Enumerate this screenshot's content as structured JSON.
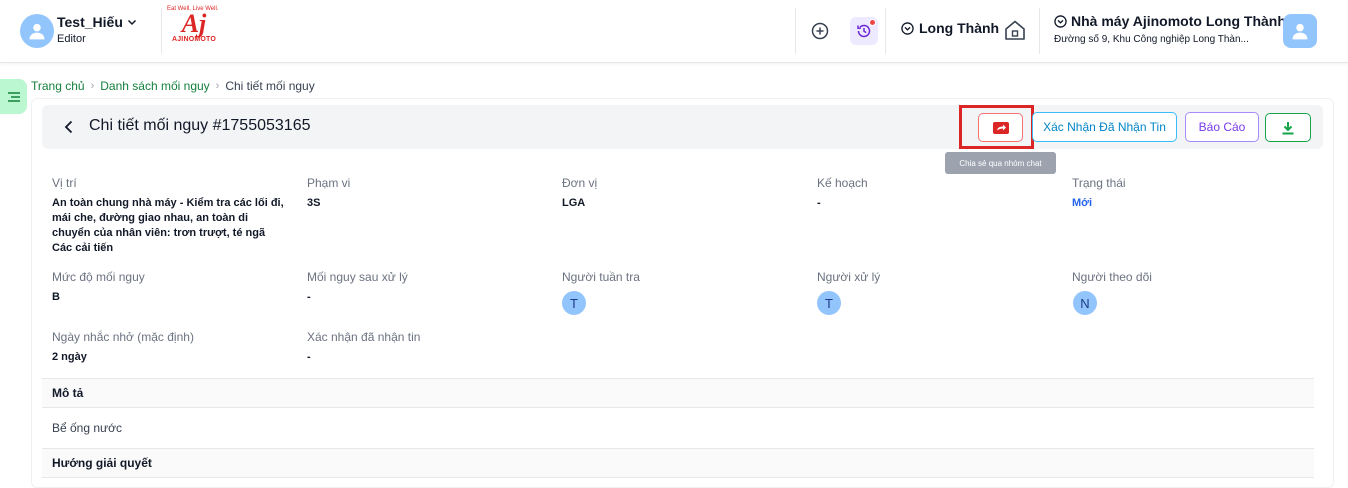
{
  "header": {
    "user_name": "Test_Hiếu",
    "user_role": "Editor",
    "logo": {
      "tagline": "Eat Well, Live Well.",
      "mark": "Aj",
      "wordmark": "AJINOMOTO"
    },
    "area_name": "Long Thành",
    "factory_name": "Nhà máy Ajinomoto Long Thành",
    "factory_address": "Đường số 9, Khu Công nghiệp Long Thàn..."
  },
  "breadcrumb": {
    "home": "Trang chủ",
    "list": "Danh sách mối nguy",
    "current": "Chi tiết mối nguy"
  },
  "detail": {
    "title": "Chi tiết mối nguy #1755053165",
    "actions": {
      "share_tooltip": "Chia sẻ qua nhóm chat",
      "confirm_label": "Xác Nhận Đã Nhận Tin",
      "report_label": "Báo Cáo"
    },
    "fields": {
      "location_label": "Vị trí",
      "location_value": "An toàn chung nhà máy - Kiểm tra các lối đi, mái che, đường giao nhau, an toàn di chuyển của nhân viên: trơn trượt, té ngã Các cải tiến",
      "scope_label": "Phạm vi",
      "scope_value": "3S",
      "unit_label": "Đơn vị",
      "unit_value": "LGA",
      "plan_label": "Kế hoạch",
      "plan_value": "-",
      "status_label": "Trạng thái",
      "status_value": "Mới",
      "severity_label": "Mức độ mối nguy",
      "severity_value": "B",
      "after_label": "Mối nguy sau xử lý",
      "after_value": "-",
      "patrol_label": "Người tuần tra",
      "patrol_initial": "T",
      "handler_label": "Người xử lý",
      "handler_initial": "T",
      "follower_label": "Người theo dõi",
      "follower_initial": "N",
      "reminder_label": "Ngày nhắc nhở (mặc định)",
      "reminder_value": "2 ngày",
      "ack_label": "Xác nhận đã nhận tin",
      "ack_value": "-"
    },
    "description_label": "Mô tả",
    "description_value": "Bể ống nước",
    "solution_label": "Hướng giải quyết"
  },
  "colors": {
    "brand_red": "#dc2626",
    "nav_green": "#15803d",
    "status_blue": "#2563eb",
    "avatar_blue": "#93c5fd"
  }
}
